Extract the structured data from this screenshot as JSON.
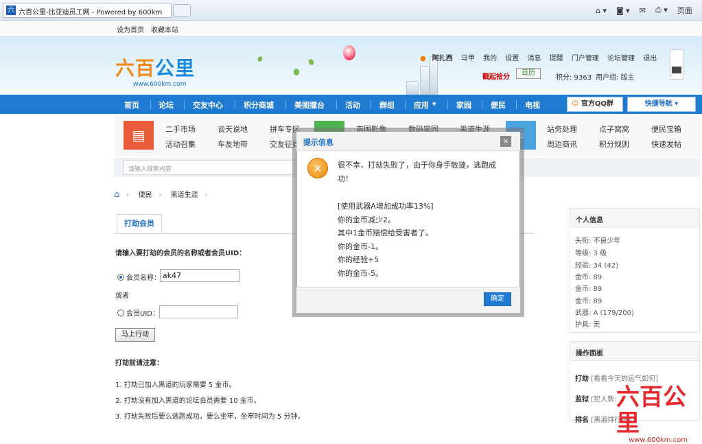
{
  "browser": {
    "tab_title": "六百公里-比亚迪员工网 - Powered by 600km",
    "tab_favicon": "六",
    "tools_page": "页面"
  },
  "topbar": {
    "set_home": "设为首页",
    "bookmark": "收藏本站"
  },
  "header": {
    "logo_text_a": "六百",
    "logo_text_b": "公里",
    "logo_url": "www.600km.com",
    "user": {
      "username": "阿扎西",
      "items": [
        "马甲",
        "我的",
        "设置",
        "消息",
        "提醒",
        "门户管理",
        "论坛管理",
        "退出"
      ],
      "sign_in": "戳起拾分",
      "daily": "日历",
      "points": "积分: 9363",
      "group": "用户组: 版主"
    }
  },
  "nav": {
    "items": [
      "首页",
      "论坛",
      "交友中心",
      "积分商城",
      "美图擂台",
      "活动",
      "群组",
      "应用",
      "家园",
      "便民",
      "电视"
    ],
    "qq": "官方QQ群",
    "quick": "快捷导航 ▾"
  },
  "sub": {
    "col1": [
      "二手市场",
      "活动召集"
    ],
    "col2": [
      "谈天说地",
      "车友地带"
    ],
    "col3": [
      "拼车专区",
      "交友征婚"
    ],
    "col4": [
      "南国影像",
      "数码家园"
    ],
    "col5": [
      "黑道生涯"
    ],
    "col6": [
      "站务处理",
      "周边商讯"
    ],
    "col7": [
      "点子窝窝",
      "积分规则"
    ],
    "col8": [
      "便民宝箱",
      "快速发帖"
    ],
    "search_placeholder": "请输入搜索内容"
  },
  "breadcrumb": [
    "便民",
    "黑道生涯"
  ],
  "main": {
    "tab": "打劫会员",
    "prompt": "请输入要打劫的会员的名称或者会员UID：",
    "name_label": "会员名称：",
    "name_value": "ak47",
    "or": "或者",
    "uid_label": "会员UID：",
    "action": "马上行动",
    "notes_title": "打劫前请注意：",
    "notes": [
      "1. 打劫已加入黑道的玩家需要 5 金币。",
      "2. 打劫没有加入黑道的论坛会员需要 10 金币。",
      "3. 打劫失败后要么逃跑成功，要么坐牢，坐牢时间为 5 分钟。"
    ]
  },
  "profile": {
    "title": "个人信息",
    "rows": [
      "头衔: 不良少年",
      "等级: 3 级",
      "经验: 34 (42)",
      "金币: 89",
      "金币: 89",
      "金币: 89",
      "武器: A (179/200)",
      "护具: 无"
    ]
  },
  "ops": {
    "title": "操作面板",
    "rows": [
      {
        "label": "打劫",
        "desc": "[看看今天的运气如何]"
      },
      {
        "label": "监狱",
        "desc": "[犯人数: "
      },
      {
        "label": "排名",
        "desc": "[黑道排行榜]"
      }
    ]
  },
  "dialog": {
    "title": "提示信息",
    "close": "×",
    "icon": "✕",
    "line1": "很不幸，打劫失败了，由于你身手敏捷，逃跑成",
    "line2": "功！",
    "details": [
      "[使用武器A增加成功率13%]",
      "你的金币减少2。",
      "其中1金币赔偿给受害者了。",
      "你的金币-1。",
      "你的经验+5",
      "你的金币-5。"
    ],
    "ok": "确定"
  },
  "watermark": {
    "text": "六百公里",
    "url": "www.600km.com"
  }
}
